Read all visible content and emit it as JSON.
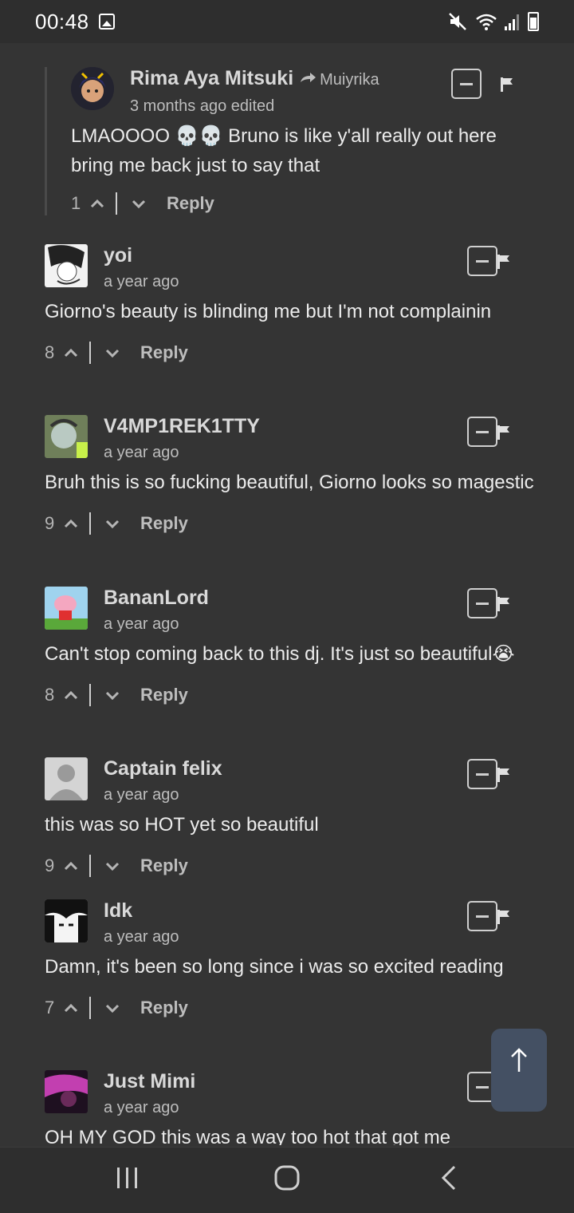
{
  "status_bar": {
    "time": "00:48"
  },
  "comments": [
    {
      "name": "Rima Aya Mitsuki",
      "reply_to": "Muiyrika",
      "time": "3 months ago edited",
      "body": "LMAOOOO 💀💀 Bruno is like y'all really out here bring me back just to say that",
      "votes": "1",
      "reply_label": "Reply",
      "avatar_color": "#2a2a3a"
    },
    {
      "name": "yoi",
      "time": "a year ago",
      "body": "Giorno's beauty is blinding me but I'm not complainin",
      "votes": "8",
      "reply_label": "Reply",
      "avatar_color": "#e9e9e9"
    },
    {
      "name": "V4MP1REK1TTY",
      "time": "a year ago",
      "body": "Bruh this is so fucking beautiful, Giorno looks so magestic",
      "votes": "9",
      "reply_label": "Reply",
      "avatar_color": "#7a8b6a"
    },
    {
      "name": "BananLord",
      "time": "a year ago",
      "body": "Can't stop coming back to this dj. It's just so beautiful😭",
      "votes": "8",
      "reply_label": "Reply",
      "avatar_color": "#9fd3ee"
    },
    {
      "name": "Captain felix",
      "time": "a year ago",
      "body": "this was so HOT yet so beautiful",
      "votes": "9",
      "reply_label": "Reply",
      "avatar_color": "#cfcfcf"
    },
    {
      "name": "Idk",
      "time": "a year ago",
      "body": "Damn, it's been so long since i was so excited reading",
      "votes": "7",
      "reply_label": "Reply",
      "avatar_color": "#1b1b1b"
    },
    {
      "name": "Just Mimi",
      "time": "a year ago",
      "body": "OH MY GOD this was a way too hot that got me",
      "avatar_color": "#3a1f3a"
    }
  ]
}
